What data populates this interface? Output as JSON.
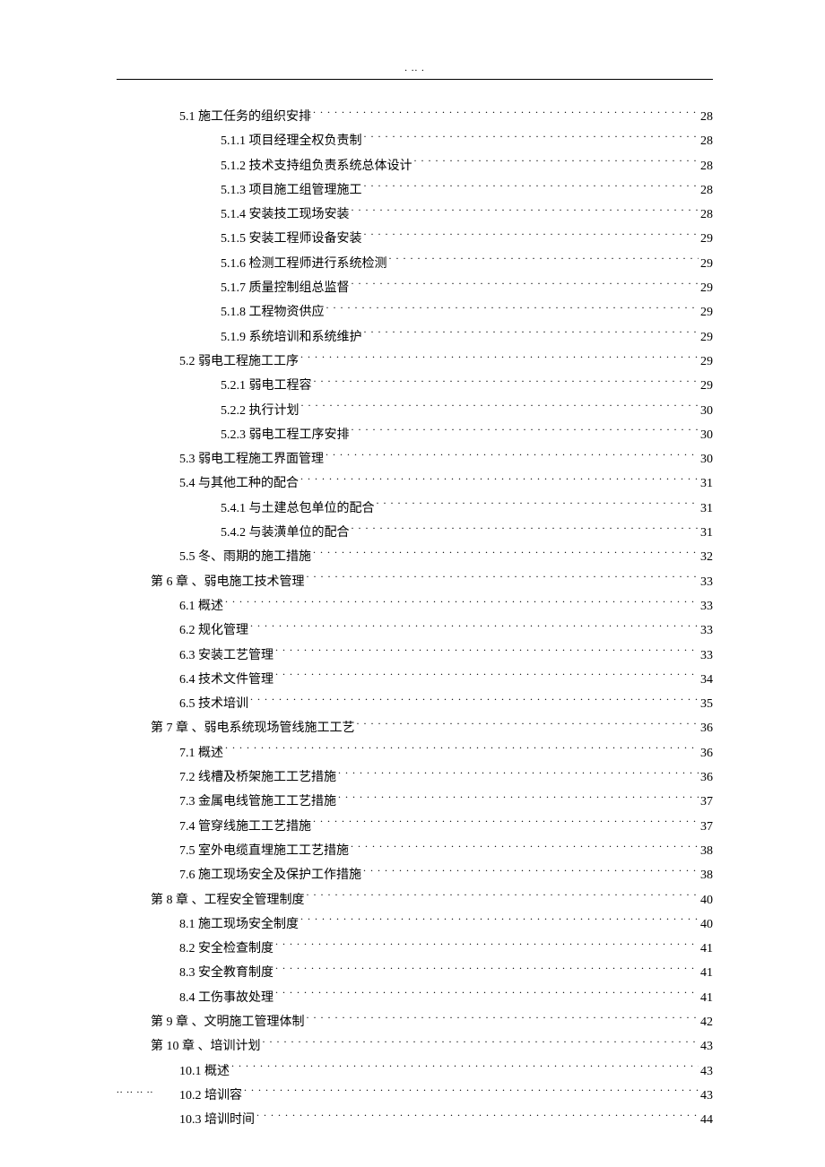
{
  "header_dots": ".               ..            .",
  "footer_dots": "..            ..                                  ..             ..",
  "toc": [
    {
      "level": 2,
      "label": "5.1 施工任务的组织安排",
      "page": "28"
    },
    {
      "level": 3,
      "label": "5.1.1 项目经理全权负责制",
      "page": "28"
    },
    {
      "level": 3,
      "label": "5.1.2 技术支持组负责系统总体设计",
      "page": "28"
    },
    {
      "level": 3,
      "label": "5.1.3 项目施工组管理施工",
      "page": "28"
    },
    {
      "level": 3,
      "label": "5.1.4 安装技工现场安装",
      "page": "28"
    },
    {
      "level": 3,
      "label": "5.1.5 安装工程师设备安装",
      "page": "29"
    },
    {
      "level": 3,
      "label": "5.1.6 检测工程师进行系统检测",
      "page": "29"
    },
    {
      "level": 3,
      "label": "5.1.7 质量控制组总监督",
      "page": "29"
    },
    {
      "level": 3,
      "label": "5.1.8 工程物资供应",
      "page": "29"
    },
    {
      "level": 3,
      "label": "5.1.9 系统培训和系统维护",
      "page": "29"
    },
    {
      "level": 2,
      "label": "5.2 弱电工程施工工序",
      "page": "29"
    },
    {
      "level": 3,
      "label": "5.2.1 弱电工程容",
      "page": "29"
    },
    {
      "level": 3,
      "label": "5.2.2 执行计划",
      "page": "30"
    },
    {
      "level": 3,
      "label": "5.2.3 弱电工程工序安排",
      "page": "30"
    },
    {
      "level": 2,
      "label": "5.3 弱电工程施工界面管理",
      "page": "30"
    },
    {
      "level": 2,
      "label": "5.4 与其他工种的配合",
      "page": "31"
    },
    {
      "level": 3,
      "label": "5.4.1 与土建总包单位的配合",
      "page": "31"
    },
    {
      "level": 3,
      "label": "5.4.2 与装潢单位的配合",
      "page": "31"
    },
    {
      "level": 2,
      "label": "5.5 冬、雨期的施工措施",
      "page": "32"
    },
    {
      "level": 1,
      "label": "第 6 章 、弱电施工技术管理",
      "page": "33"
    },
    {
      "level": 2,
      "label": "6.1 概述",
      "page": "33"
    },
    {
      "level": 2,
      "label": "6.2 规化管理",
      "page": "33"
    },
    {
      "level": 2,
      "label": "6.3 安装工艺管理",
      "page": "33"
    },
    {
      "level": 2,
      "label": "6.4 技术文件管理",
      "page": "34"
    },
    {
      "level": 2,
      "label": "6.5 技术培训",
      "page": "35"
    },
    {
      "level": 1,
      "label": "第 7 章 、弱电系统现场管线施工工艺",
      "page": "36"
    },
    {
      "level": 2,
      "label": "7.1 概述",
      "page": "36"
    },
    {
      "level": 2,
      "label": "7.2 线槽及桥架施工工艺措施",
      "page": "36"
    },
    {
      "level": 2,
      "label": "7.3 金属电线管施工工艺措施",
      "page": "37"
    },
    {
      "level": 2,
      "label": "7.4 管穿线施工工艺措施",
      "page": "37"
    },
    {
      "level": 2,
      "label": "7.5 室外电缆直埋施工工艺措施",
      "page": "38"
    },
    {
      "level": 2,
      "label": "7.6 施工现场安全及保护工作措施",
      "page": "38"
    },
    {
      "level": 1,
      "label": "第 8 章 、工程安全管理制度",
      "page": "40"
    },
    {
      "level": 2,
      "label": "8.1 施工现场安全制度",
      "page": "40"
    },
    {
      "level": 2,
      "label": "8.2 安全检查制度",
      "page": "41"
    },
    {
      "level": 2,
      "label": "8.3 安全教育制度",
      "page": "41"
    },
    {
      "level": 2,
      "label": "8.4 工伤事故处理",
      "page": "41"
    },
    {
      "level": 1,
      "label": "第 9 章 、文明施工管理体制",
      "page": "42"
    },
    {
      "level": 1,
      "label": "第 10 章 、培训计划",
      "page": "43"
    },
    {
      "level": 2,
      "label": "10.1 概述",
      "page": "43"
    },
    {
      "level": 2,
      "label": "10.2 培训容",
      "page": "43"
    },
    {
      "level": 2,
      "label": "10.3 培训时间",
      "page": "44"
    }
  ]
}
